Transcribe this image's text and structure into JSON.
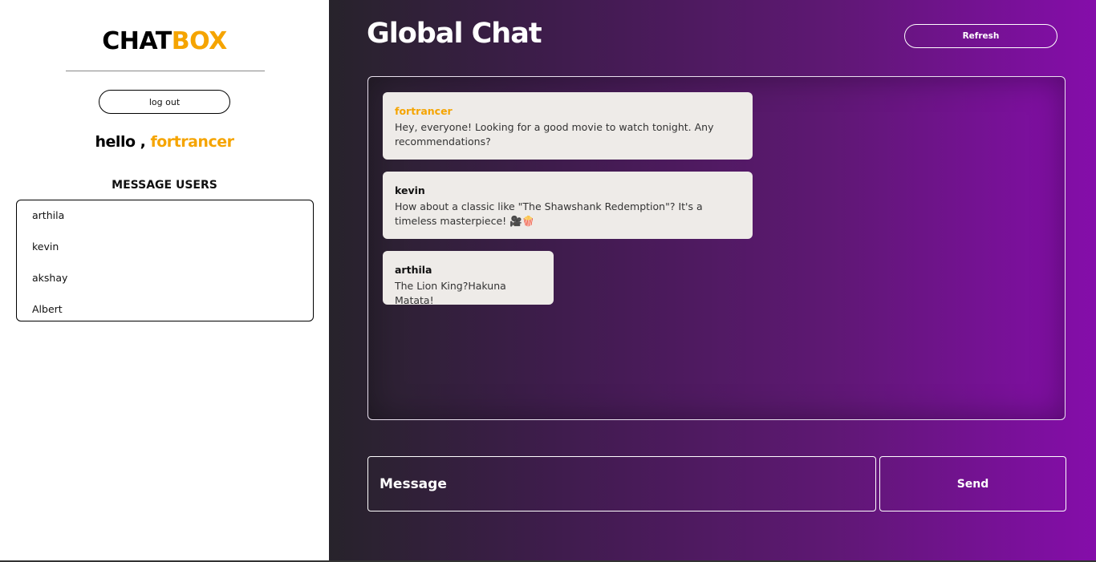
{
  "sidebar": {
    "brand_part1": "CHAT",
    "brand_part2": "BOX",
    "logout_label": "log out",
    "greeting_prefix": "hello ,",
    "current_user": "fortrancer",
    "section_title": "MESSAGE USERS",
    "users": [
      "arthila",
      "kevin",
      "akshay",
      "Albert"
    ]
  },
  "main": {
    "title": "Global Chat",
    "refresh_label": "Refresh",
    "messages": [
      {
        "sender": "fortrancer",
        "text": "Hey, everyone! Looking for a good movie to watch tonight. Any recommendations?"
      },
      {
        "sender": "kevin",
        "text": "How about a classic like \"The Shawshank Redemption\"? It's a timeless masterpiece! 🎥🍿"
      },
      {
        "sender": "arthila",
        "text": "The Lion King?Hakuna Matata!"
      }
    ],
    "message_placeholder": "Message",
    "send_label": "Send"
  },
  "colors": {
    "accent": "#f5a400",
    "gradient_start": "#27232b",
    "gradient_end": "#850daa"
  }
}
